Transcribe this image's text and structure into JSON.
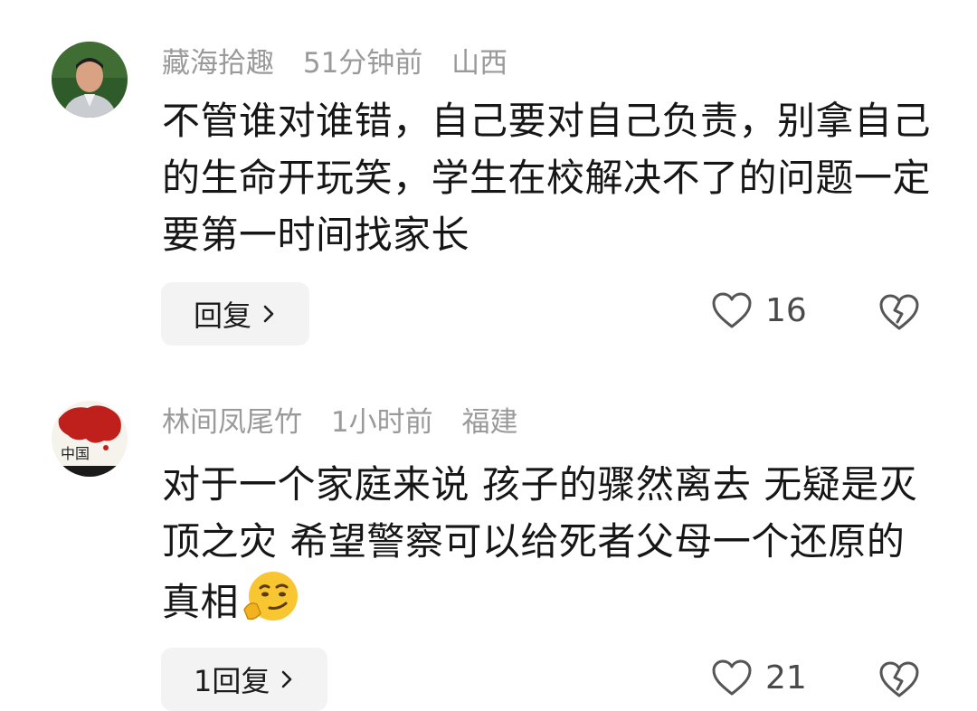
{
  "comments": [
    {
      "username": "藏海拾趣",
      "time": "51分钟前",
      "location": "山西",
      "text": "不管谁对谁错，自己要对自己负责，别拿自己的生命开玩笑，学生在校解决不了的问题一定要第一时间找家长",
      "reply_label": "回复",
      "likes": "16",
      "avatar_icon": "person-photo-avatar"
    },
    {
      "username": "林间凤尾竹",
      "time": "1小时前",
      "location": "福建",
      "text": "对于一个家庭来说 孩子的骤然离去 无疑是灭顶之灾 希望警察可以给死者父母一个还原的真相",
      "emoji": "smirk-thinking-emoji",
      "reply_label": "1回复",
      "likes": "21",
      "avatar_icon": "china-map-avatar"
    }
  ],
  "icons": {
    "like": "heart-outline-icon",
    "dislike": "broken-heart-icon",
    "chevron": "chevron-right-icon"
  },
  "colors": {
    "meta": "#9a9a9a",
    "text": "#161616",
    "button_bg": "#f3f3f3"
  }
}
